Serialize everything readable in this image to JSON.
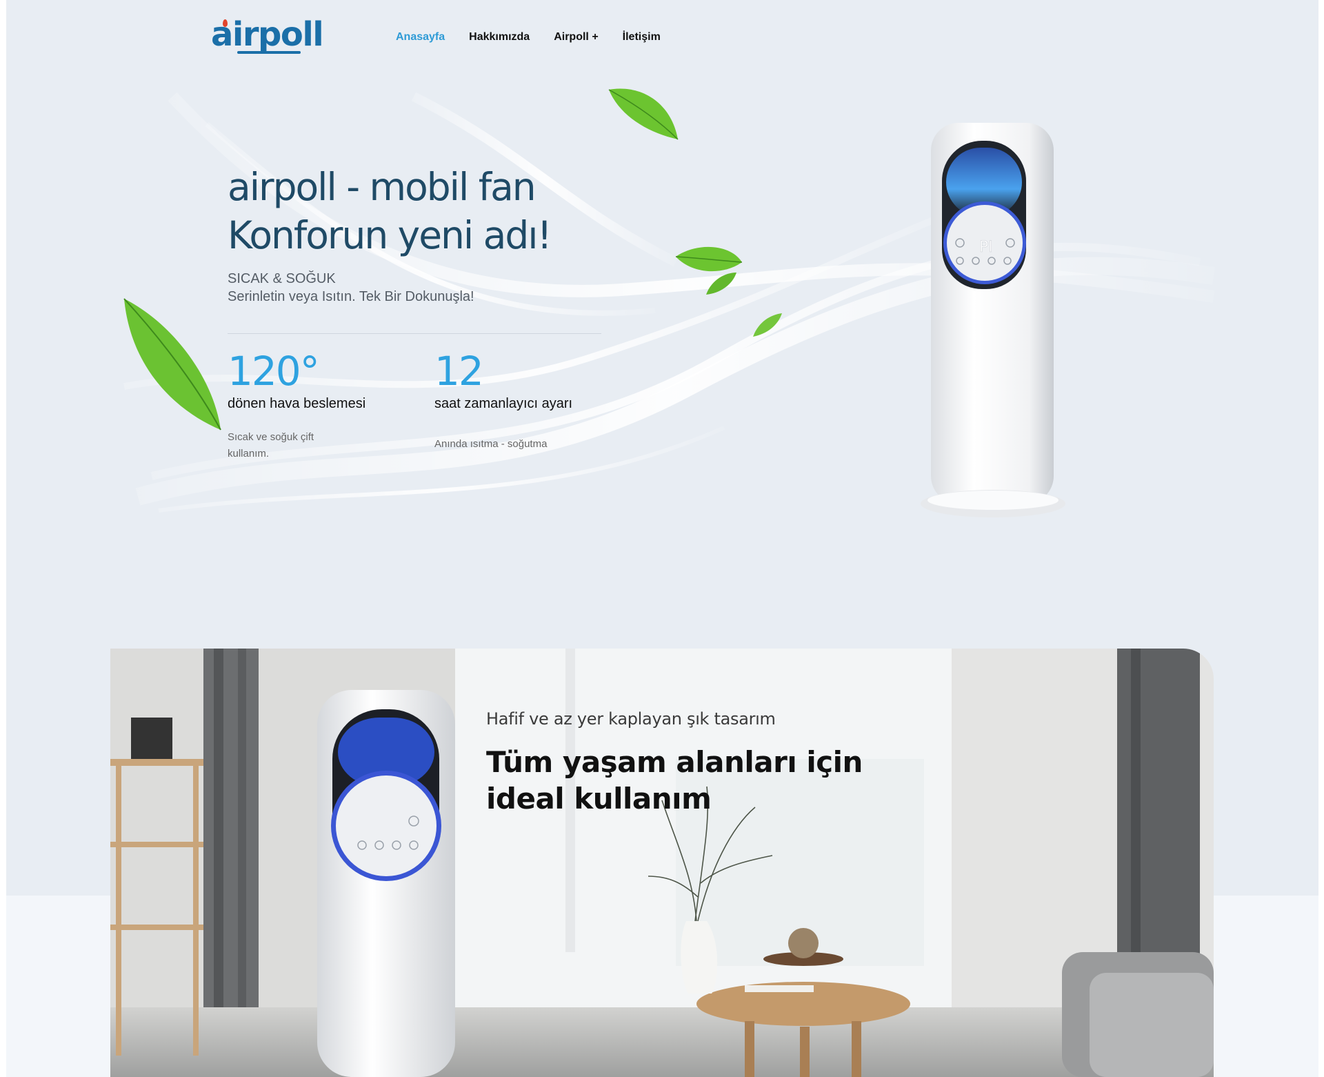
{
  "brand": {
    "name": "airpoll"
  },
  "nav": {
    "items": [
      {
        "label": "Anasayfa",
        "active": true
      },
      {
        "label": "Hakkımızda",
        "active": false
      },
      {
        "label": "Airpoll +",
        "active": false
      },
      {
        "label": "İletişim",
        "active": false
      }
    ]
  },
  "hero": {
    "title_line1": "airpoll - mobil fan",
    "title_line2": "Konforun yeni adı!",
    "subtitle": "SICAK & SOĞUK",
    "tagline": "Serinletin veya Isıtın. Tek Bir Dokunuşla!",
    "stats": [
      {
        "value": "120°",
        "label": "dönen hava beslemesi",
        "desc_line1": "Sıcak ve soğuk çift",
        "desc_line2": "kullanım."
      },
      {
        "value": "12",
        "label": "saat zamanlayıcı ayarı",
        "desc_line1": "Anında ısıtma - soğutma"
      }
    ]
  },
  "product": {
    "display_text": "PI"
  },
  "feature": {
    "eyebrow": "Hafif ve az yer kaplayan şık tasarım",
    "title_line1": "Tüm yaşam alanları için",
    "title_line2": "ideal kullanım"
  },
  "colors": {
    "accent": "#2ea2e0",
    "brand": "#1b6fa8",
    "title": "#1f4a66",
    "hero_bg": "#e8edf3"
  }
}
